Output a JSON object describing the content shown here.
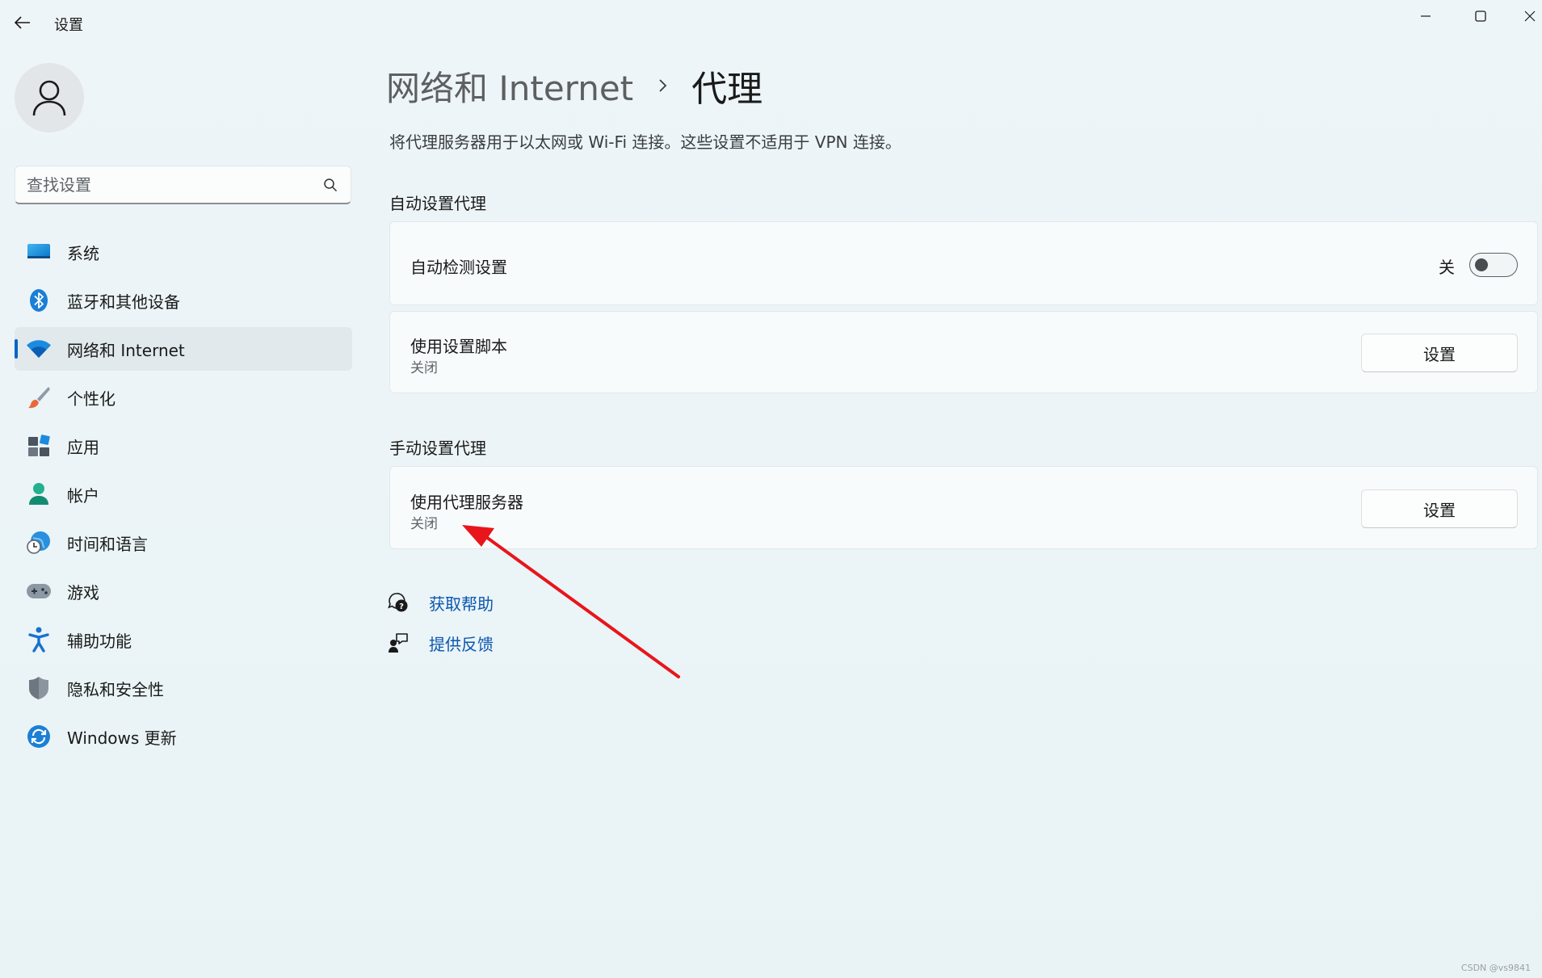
{
  "window": {
    "title": "设置",
    "back_icon": "back-arrow-icon",
    "controls": [
      "minimize-icon",
      "maximize-icon",
      "close-icon"
    ]
  },
  "sidebar": {
    "avatar_icon": "user-icon",
    "search": {
      "placeholder": "查找设置",
      "value": "",
      "icon": "search-icon"
    },
    "items": [
      {
        "label": "系统",
        "icon": "system-display-icon",
        "selected": false
      },
      {
        "label": "蓝牙和其他设备",
        "icon": "bluetooth-icon",
        "selected": false
      },
      {
        "label": "网络和 Internet",
        "icon": "wifi-icon",
        "selected": true
      },
      {
        "label": "个性化",
        "icon": "brush-icon",
        "selected": false
      },
      {
        "label": "应用",
        "icon": "apps-icon",
        "selected": false
      },
      {
        "label": "帐户",
        "icon": "account-icon",
        "selected": false
      },
      {
        "label": "时间和语言",
        "icon": "globe-clock-icon",
        "selected": false
      },
      {
        "label": "游戏",
        "icon": "gamepad-icon",
        "selected": false
      },
      {
        "label": "辅助功能",
        "icon": "accessibility-icon",
        "selected": false
      },
      {
        "label": "隐私和安全性",
        "icon": "shield-icon",
        "selected": false
      },
      {
        "label": "Windows 更新",
        "icon": "update-icon",
        "selected": false
      }
    ]
  },
  "main": {
    "breadcrumb": {
      "parent": "网络和 Internet",
      "current": "代理"
    },
    "description": "将代理服务器用于以太网或 Wi-Fi 连接。这些设置不适用于 VPN 连接。",
    "auto_section": {
      "title": "自动设置代理",
      "auto_detect": {
        "title": "自动检测设置",
        "state_label": "关",
        "enabled": false
      },
      "script": {
        "title": "使用设置脚本",
        "status": "关闭",
        "button": "设置"
      }
    },
    "manual_section": {
      "title": "手动设置代理",
      "proxy": {
        "title": "使用代理服务器",
        "status": "关闭",
        "button": "设置"
      }
    },
    "links": {
      "help": {
        "label": "获取帮助",
        "icon": "help-chat-icon"
      },
      "feedback": {
        "label": "提供反馈",
        "icon": "feedback-icon"
      }
    }
  },
  "annotation": {
    "arrow_color": "#e8151b"
  },
  "watermark": "CSDN @vs9841",
  "colors": {
    "accent": "#0067c0",
    "link": "#0b57b0"
  }
}
